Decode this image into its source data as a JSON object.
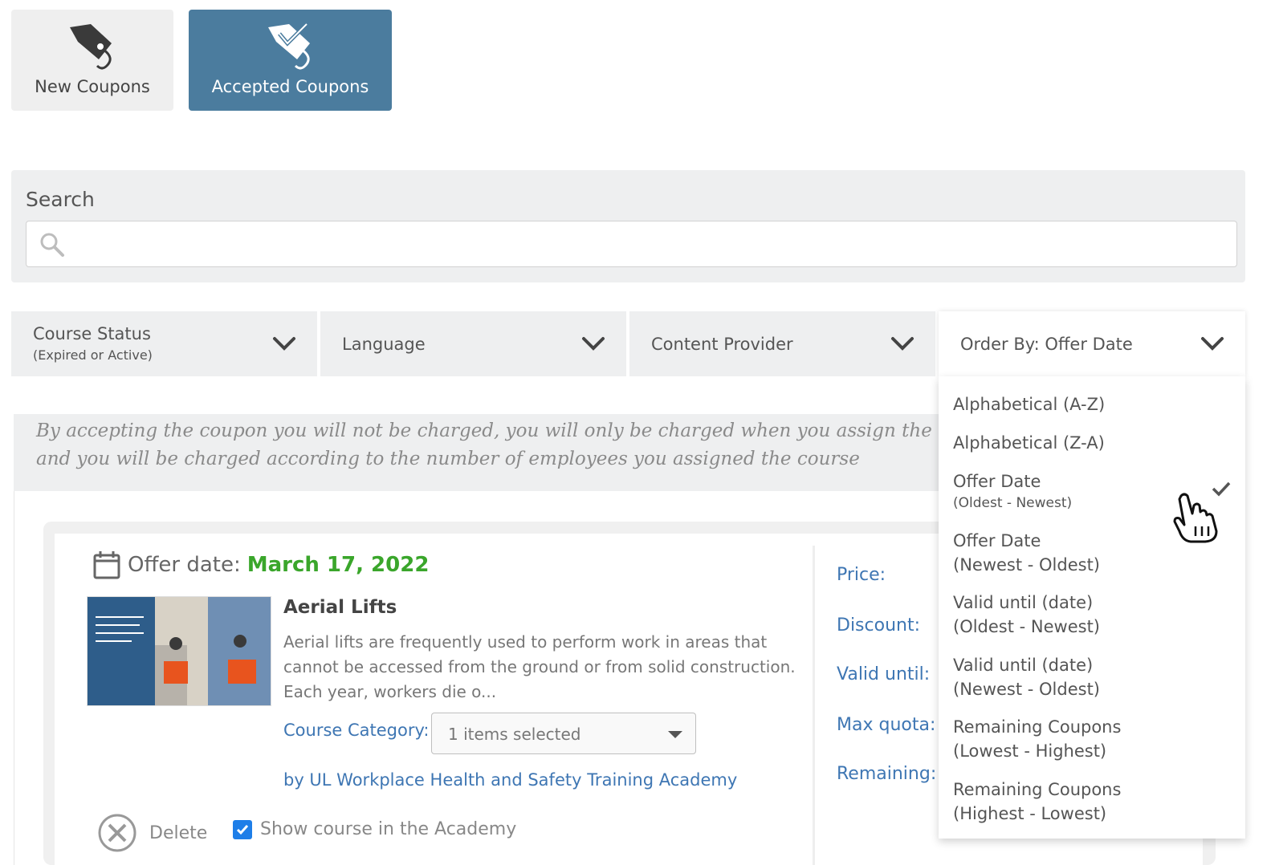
{
  "tabs": {
    "new_label": "New Coupons",
    "accepted_label": "Accepted Coupons",
    "active_color": "#4b7c9e"
  },
  "search": {
    "title": "Search",
    "placeholder": "",
    "icon": "search-icon"
  },
  "filters": {
    "status_label": "Course Status",
    "status_sub": "(Expired or Active)",
    "language_label": "Language",
    "provider_label": "Content Provider",
    "order_label": "Order By: Offer Date"
  },
  "order_options": [
    {
      "line1": "Alphabetical (A-Z)",
      "line2": ""
    },
    {
      "line1": "Alphabetical (Z-A)",
      "line2": ""
    },
    {
      "line1": "Offer Date",
      "line2": "(Oldest - Newest)",
      "selected": true
    },
    {
      "line1": "Offer Date",
      "line2": "(Newest - Oldest)"
    },
    {
      "line1": "Valid until (date)",
      "line2": "(Oldest - Newest)"
    },
    {
      "line1": "Valid until (date)",
      "line2": "(Newest - Oldest)"
    },
    {
      "line1": "Remaining Coupons",
      "line2": "(Lowest - Highest)"
    },
    {
      "line1": "Remaining Coupons",
      "line2": "(Highest - Lowest)"
    }
  ],
  "notice": {
    "text": "By accepting the coupon you will not be charged, you will only be charged when you assign the course to employees, and you will be charged according to the number of employees you assigned the course"
  },
  "coupon": {
    "offer_date_label": "Offer date:",
    "offer_date_value": "March 17, 2022",
    "offer_date_color": "#3aa62b",
    "title": "Aerial Lifts",
    "description": "Aerial lifts are frequently used to perform work in areas that cannot be accessed from the ground or from solid construction. Each year, workers die o...",
    "category_label": "Course Category:",
    "category_value": "1 items selected",
    "provider": "by UL Workplace Health and Safety Training Academy",
    "delete_label": "Delete",
    "show_label": "Show course in the Academy",
    "show_checked": true
  },
  "side_fields": {
    "price": "Price:",
    "discount": "Discount:",
    "valid_until": "Valid until:",
    "max_quota": "Max quota:",
    "remaining": "Remaining:"
  }
}
